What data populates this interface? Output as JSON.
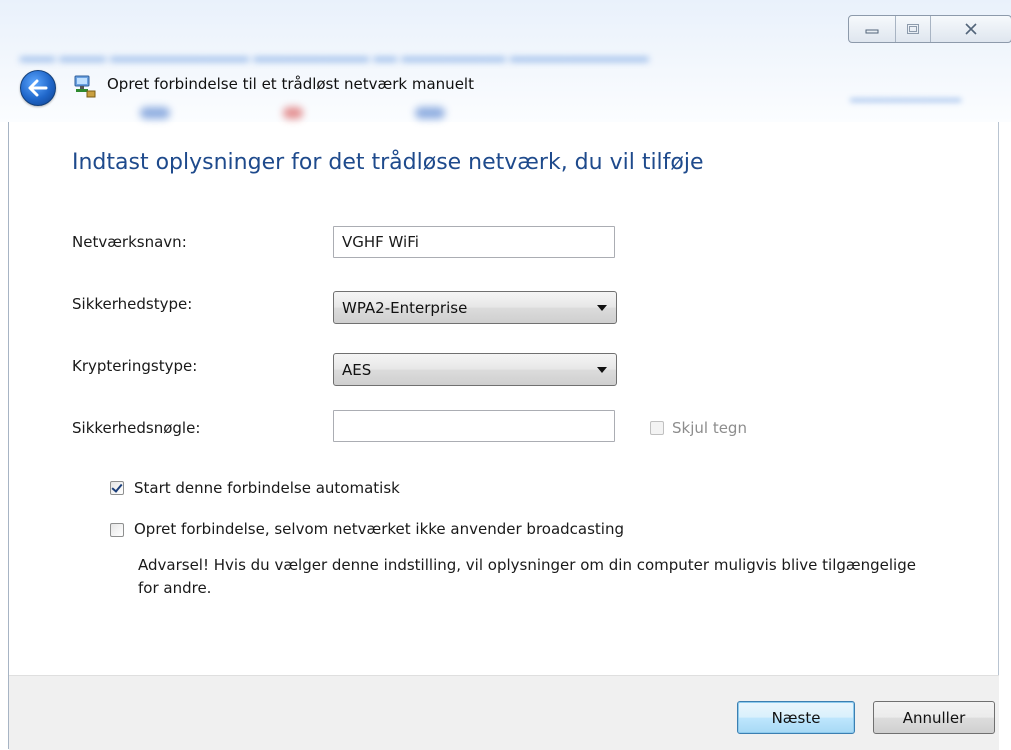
{
  "window": {
    "breadcrumb_title": "Opret forbindelse til et trådløst netværk manuelt",
    "controls": {
      "minimize_icon": "minimize-icon",
      "maximize_icon": "maximize-icon",
      "close_icon": "close-icon"
    }
  },
  "page": {
    "heading": "Indtast oplysninger for det trådløse netværk, du vil tilføje"
  },
  "form": {
    "network_name": {
      "label": "Netværksnavn:",
      "value": "VGHF WiFi"
    },
    "security_type": {
      "label": "Sikkerhedstype:",
      "selected": "WPA2-Enterprise"
    },
    "encryption_type": {
      "label": "Krypteringstype:",
      "selected": "AES"
    },
    "security_key": {
      "label": "Sikkerhedsnøgle:",
      "value": "",
      "hide_chars_label": "Skjul tegn",
      "hide_chars_checked": false,
      "hide_chars_disabled": true
    },
    "auto_start": {
      "label": "Start denne forbindelse automatisk",
      "checked": true
    },
    "connect_hidden": {
      "label": "Opret forbindelse, selvom netværket ikke anvender broadcasting",
      "checked": false
    },
    "warning_text": "Advarsel! Hvis du vælger denne indstilling, vil oplysninger om din computer muligvis blive tilgængelige for andre."
  },
  "footer": {
    "next_label": "Næste",
    "cancel_label": "Annuller"
  },
  "colors": {
    "heading": "#1e4a8c",
    "accent_button_border": "#3c7fb1",
    "footer_bg": "#f0f0f0"
  }
}
